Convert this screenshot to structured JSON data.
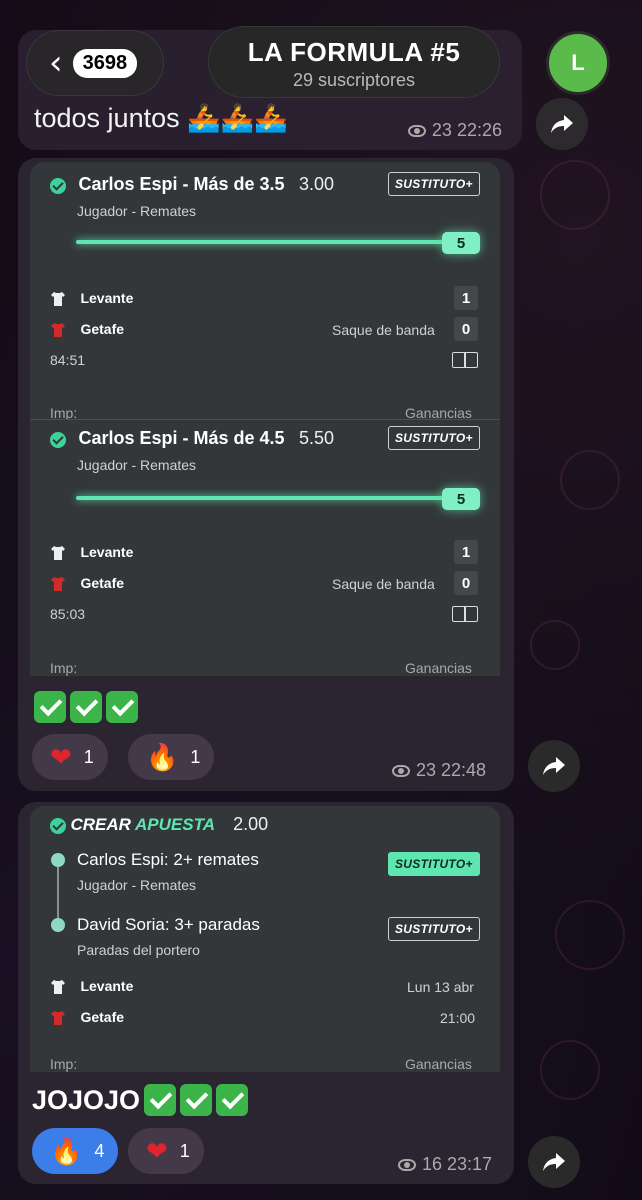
{
  "header": {
    "back_count": "3698",
    "channel_title": "LA FORMULA #5",
    "subscribers": "29 suscriptores",
    "avatar_letter": "L"
  },
  "prev_message": {
    "text": "todos juntos 🚣🚣🚣",
    "views_time": "23 22:26"
  },
  "message1": {
    "cards": [
      {
        "pick": "Carlos Espi - Más de 3.5",
        "odds": "3.00",
        "badge": "SUSTITUTO+",
        "market": "Jugador - Remates",
        "progress_value": "5",
        "home_team": "Levante",
        "home_score": "1",
        "away_team": "Getafe",
        "away_score": "0",
        "event": "Saque de banda",
        "clock": "84:51",
        "stake_label": "Imp:",
        "winnings_label": "Ganancias"
      },
      {
        "pick": "Carlos Espi - Más de 4.5",
        "odds": "5.50",
        "badge": "SUSTITUTO+",
        "market": "Jugador - Remates",
        "progress_value": "5",
        "home_team": "Levante",
        "home_score": "1",
        "away_team": "Getafe",
        "away_score": "0",
        "event": "Saque de banda",
        "clock": "85:03",
        "stake_label": "Imp:",
        "winnings_label": "Ganancias"
      }
    ],
    "reactions": [
      {
        "emoji": "❤",
        "count": "1"
      },
      {
        "emoji": "🔥",
        "count": "1"
      }
    ],
    "views_time": "23 22:48"
  },
  "message2": {
    "crear_label_1": "CREAR",
    "crear_label_2": "APUESTA",
    "odds": "2.00",
    "legs": [
      {
        "pick": "Carlos Espi: 2+ remates",
        "market": "Jugador - Remates",
        "badge": "SUSTITUTO+"
      },
      {
        "pick": "David Soria: 3+ paradas",
        "market": "Paradas del portero",
        "badge": "SUSTITUTO+"
      }
    ],
    "home_team": "Levante",
    "away_team": "Getafe",
    "date": "Lun 13 abr",
    "time": "21:00",
    "stake_label": "Imp:",
    "winnings_label": "Ganancias",
    "text": "JOJOJO",
    "reactions": [
      {
        "emoji": "🔥",
        "count": "4"
      },
      {
        "emoji": "❤",
        "count": "1"
      }
    ],
    "views_time": "16 23:17"
  }
}
